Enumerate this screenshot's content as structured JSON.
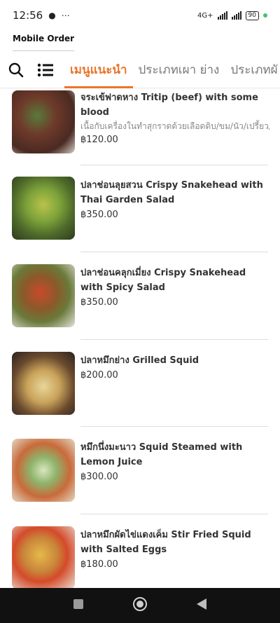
{
  "status": {
    "time": "12:56",
    "network": "4G+",
    "battery": "90"
  },
  "app": {
    "title": "Mobile Order"
  },
  "tabs": [
    {
      "label": "เมนูแนะนำ",
      "active": true
    },
    {
      "label": "ประเภทเผา ย่าง",
      "active": false
    },
    {
      "label": "ประเภทผั",
      "active": false
    }
  ],
  "items": [
    {
      "name": "จระเข้ฟาดหาง Tritip (beef) with some blood",
      "desc": "เนื้อกับเครื่องในทำสุกราดด้วยเลือดดิบ/ขม/นัว/เปรี้ยว/",
      "price": "฿120.00"
    },
    {
      "name": "ปลาช่อนลุยสวน Crispy Snakehead with Thai Garden Salad",
      "desc": "",
      "price": "฿350.00"
    },
    {
      "name": "ปลาช่อนคลุกเมี่ยง Crispy Snakehead with Spicy Salad",
      "desc": "",
      "price": "฿350.00"
    },
    {
      "name": "ปลาหมึกย่าง Grilled Squid",
      "desc": "",
      "price": "฿200.00"
    },
    {
      "name": "หมึกนึ่งมะนาว Squid Steamed with Lemon Juice",
      "desc": "",
      "price": "฿300.00"
    },
    {
      "name": "ปลาหมึกผัดไข่แดงเค็ม Stir Fried Squid with Salted Eggs",
      "desc": "",
      "price": "฿180.00"
    }
  ],
  "colors": {
    "accent": "#e8762c"
  }
}
